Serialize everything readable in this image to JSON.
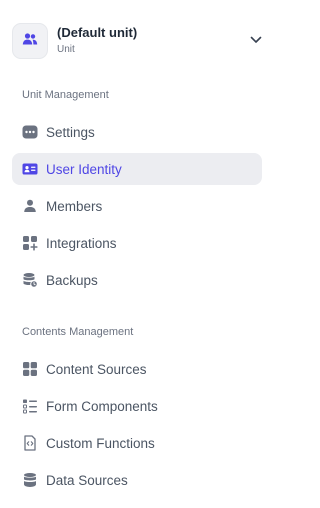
{
  "unit": {
    "title": "(Default unit)",
    "subtitle": "Unit",
    "avatar_icon": "users-icon",
    "chevron_icon": "chevron-down-icon"
  },
  "colors": {
    "accent": "#4f46e5",
    "active_bg": "#ecedf1",
    "icon_gray": "#6b7280"
  },
  "unit_management": {
    "title": "Unit Management",
    "items": [
      {
        "label": "Settings",
        "icon": "dots-icon",
        "active": false
      },
      {
        "label": "User Identity",
        "icon": "id-card-icon",
        "active": true
      },
      {
        "label": "Members",
        "icon": "person-icon",
        "active": false
      },
      {
        "label": "Integrations",
        "icon": "grid-plus-icon",
        "active": false
      },
      {
        "label": "Backups",
        "icon": "database-clock-icon",
        "active": false
      }
    ]
  },
  "contents_management": {
    "title": "Contents Management",
    "items": [
      {
        "label": "Content Sources",
        "icon": "grid-icon",
        "active": false
      },
      {
        "label": "Form Components",
        "icon": "form-list-icon",
        "active": false
      },
      {
        "label": "Custom Functions",
        "icon": "code-file-icon",
        "active": false
      },
      {
        "label": "Data Sources",
        "icon": "database-icon",
        "active": false
      }
    ]
  }
}
